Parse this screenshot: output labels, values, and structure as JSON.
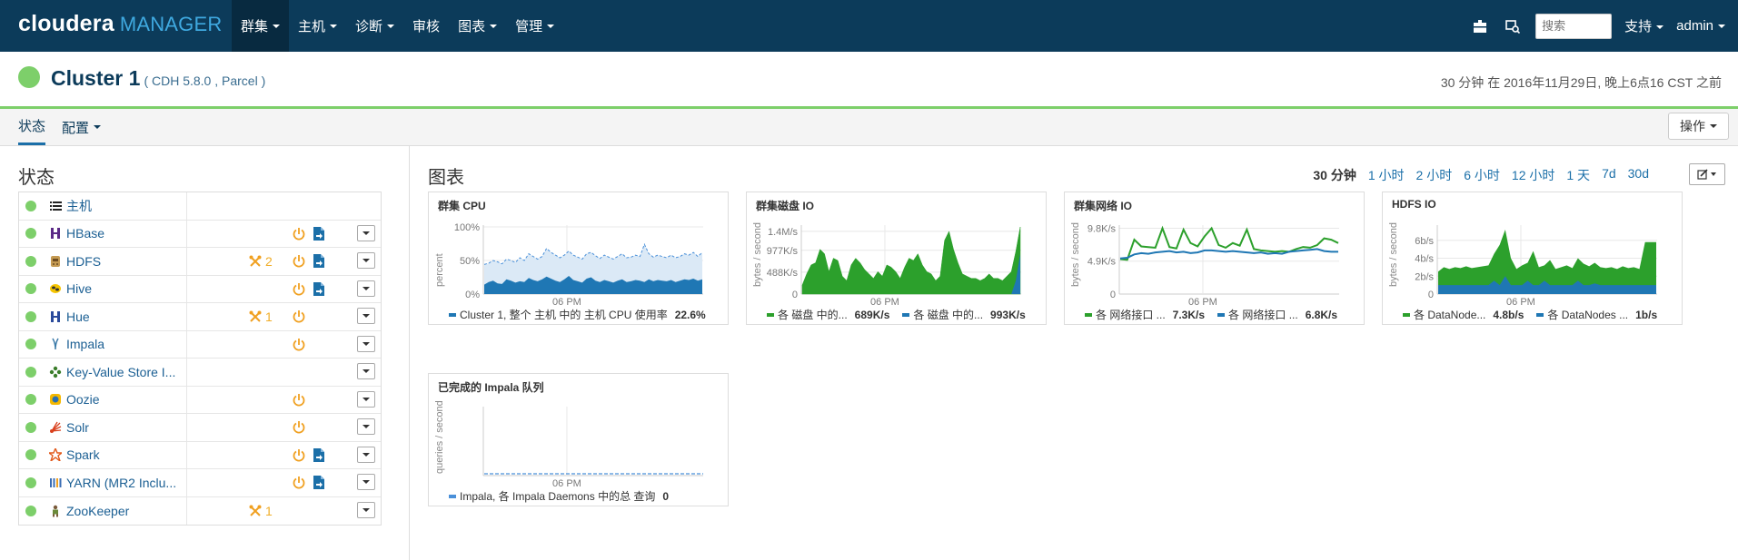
{
  "app": {
    "brand": "cloudera",
    "brand_suffix": "MANAGER",
    "nav": [
      {
        "label": "群集",
        "active": true
      },
      {
        "label": "主机"
      },
      {
        "label": "诊断"
      },
      {
        "label": "审核"
      },
      {
        "label": "图表"
      },
      {
        "label": "管理"
      }
    ],
    "search_placeholder": "搜索",
    "support_label": "支持",
    "user_label": "admin",
    "accent": "#0c3b5a"
  },
  "header": {
    "cluster_name": "Cluster 1",
    "cluster_sub": "( CDH 5.8.0 , Parcel )",
    "timestamp": "30 分钟 在 2016年11月29日, 晚上6点16 CST 之前",
    "status_color": "#7dcf6a"
  },
  "tabs": {
    "status": "状态",
    "config": "配置",
    "actions": "操作"
  },
  "status_panel": {
    "title": "状态",
    "services": [
      {
        "name": "主机",
        "icon": "list-icon"
      },
      {
        "name": "HBase",
        "icon": "hbase-icon",
        "power": true,
        "file": true
      },
      {
        "name": "HDFS",
        "icon": "hdfs-icon",
        "alert": "2",
        "power": true,
        "file": true
      },
      {
        "name": "Hive",
        "icon": "hive-icon",
        "power": true,
        "file": true
      },
      {
        "name": "Hue",
        "icon": "hue-icon",
        "alert": "1",
        "power": true
      },
      {
        "name": "Impala",
        "icon": "impala-icon",
        "power": true
      },
      {
        "name": "Key-Value Store I...",
        "icon": "kvstore-icon"
      },
      {
        "name": "Oozie",
        "icon": "oozie-icon",
        "power": true
      },
      {
        "name": "Solr",
        "icon": "solr-icon",
        "power": true
      },
      {
        "name": "Spark",
        "icon": "spark-icon",
        "power": true,
        "file": true
      },
      {
        "name": "YARN (MR2 Inclu...",
        "icon": "yarn-icon",
        "power": true,
        "file": true
      },
      {
        "name": "ZooKeeper",
        "icon": "zookeeper-icon",
        "alert": "1"
      }
    ]
  },
  "charts_panel": {
    "title": "图表",
    "time_ranges": [
      "30 分钟",
      "1 小时",
      "2 小时",
      "6 小时",
      "12 小时",
      "1 天",
      "7d",
      "30d"
    ],
    "active_range": "30 分钟"
  },
  "chart_data": [
    {
      "type": "area",
      "title": "群集 CPU",
      "ylabel": "percent",
      "yticks": [
        "100%",
        "50%",
        "0%"
      ],
      "ylim": [
        0,
        100
      ],
      "xtick": "06 PM",
      "colors": {
        "fill": "#1f77b4",
        "band": "#dbe9f6",
        "dash": "#4a90d9"
      },
      "series": [
        {
          "name": "Cluster 1, 整个 主机 中的 主机 CPU 使用率",
          "legend_value": "22.6%",
          "values": [
            14,
            18,
            20,
            16,
            15,
            22,
            20,
            17,
            19,
            18,
            24,
            21,
            19,
            22,
            26,
            23,
            20,
            18,
            22,
            27,
            21,
            19,
            17,
            23,
            25,
            20,
            18,
            21,
            19,
            17,
            20,
            22,
            18,
            19,
            21,
            20,
            18,
            22,
            19,
            21,
            20,
            19,
            21,
            18,
            20,
            22,
            21,
            23,
            20,
            22
          ]
        },
        {
          "name": "max",
          "values": [
            44,
            46,
            50,
            48,
            45,
            52,
            50,
            47,
            54,
            50,
            60,
            56,
            52,
            56,
            68,
            62,
            58,
            54,
            58,
            64,
            58,
            55,
            52,
            60,
            62,
            57,
            53,
            58,
            55,
            52,
            56,
            60,
            54,
            55,
            58,
            56,
            74,
            60,
            55,
            58,
            56,
            54,
            58,
            54,
            56,
            60,
            58,
            62,
            56,
            62
          ]
        }
      ]
    },
    {
      "type": "area",
      "title": "群集磁盘 IO",
      "ylabel": "bytes / second",
      "yticks": [
        "1.4M/s",
        "977K/s",
        "488K/s",
        "0"
      ],
      "ylim": [
        0,
        1500
      ],
      "xtick": "06 PM",
      "colors": {
        "fill": "#2ca02c",
        "line": "#1f77b4"
      },
      "series": [
        {
          "name": "各 磁盘 中的...",
          "legend_value": "689K/s",
          "values": [
            200,
            450,
            650,
            700,
            1000,
            900,
            500,
            800,
            750,
            400,
            300,
            650,
            800,
            700,
            550,
            450,
            350,
            500,
            400,
            650,
            600,
            500,
            350,
            600,
            800,
            750,
            900,
            650,
            500,
            450,
            300,
            400,
            1200,
            1400,
            1000,
            700,
            450,
            400,
            350,
            350,
            300,
            350,
            450,
            350,
            350,
            300,
            400,
            500,
            950,
            1500
          ]
        },
        {
          "name": "各 磁盘 中的...",
          "legend_value": "993K/s",
          "values": [
            0,
            0,
            0,
            0,
            0,
            0,
            0,
            0,
            0,
            0,
            0,
            0,
            0,
            0,
            0,
            0,
            0,
            0,
            0,
            0,
            0,
            0,
            0,
            0,
            0,
            0,
            0,
            0,
            0,
            0,
            0,
            0,
            0,
            0,
            0,
            0,
            0,
            0,
            0,
            0,
            0,
            0,
            0,
            0,
            0,
            0,
            0,
            0,
            300,
            900
          ]
        }
      ]
    },
    {
      "type": "line",
      "title": "群集网络 IO",
      "ylabel": "bytes / second",
      "yticks": [
        "9.8K/s",
        "4.9K/s",
        "0"
      ],
      "ylim": [
        0,
        10000
      ],
      "xtick": "06 PM",
      "colors": {
        "a": "#2ca02c",
        "b": "#1f77b4"
      },
      "series": [
        {
          "name": "各 网络接口 ...",
          "legend_value": "7.3K/s",
          "values": [
            5200,
            5100,
            8100,
            7100,
            7000,
            6900,
            9800,
            7000,
            6800,
            9600,
            7600,
            7100,
            8600,
            9800,
            7300,
            6900,
            7600,
            7200,
            9600,
            6700,
            6500,
            6400,
            6300,
            6400,
            6300,
            6700,
            7000,
            6900,
            7300,
            8300,
            8100,
            7600
          ]
        },
        {
          "name": "各 网络接口 ...",
          "legend_value": "6.8K/s",
          "values": [
            5300,
            5400,
            5900,
            6100,
            6000,
            6200,
            6300,
            6400,
            6200,
            6300,
            6100,
            6200,
            6500,
            6500,
            6400,
            6300,
            6400,
            6300,
            6200,
            6100,
            6200,
            6000,
            6100,
            6000,
            6300,
            6400,
            6500,
            6600,
            6700,
            6400,
            6300,
            6300
          ]
        }
      ]
    },
    {
      "type": "area",
      "title": "HDFS IO",
      "ylabel": "bytes / second",
      "yticks": [
        "6b/s",
        "4b/s",
        "2b/s",
        "0"
      ],
      "ylim": [
        0,
        7.5
      ],
      "xtick": "06 PM",
      "colors": {
        "a": "#2ca02c",
        "b": "#1f77b4"
      },
      "series": [
        {
          "name": "各 DataNode...",
          "legend_value": "4.8b/s",
          "values": [
            2.5,
            3.0,
            2.8,
            3.0,
            2.9,
            3.1,
            2.9,
            3.0,
            3.1,
            3.2,
            4.5,
            5.5,
            7.2,
            4.0,
            2.8,
            3.2,
            3.5,
            4.8,
            3.0,
            3.2,
            3.8,
            2.8,
            3.0,
            3.2,
            2.9,
            4.0,
            3.4,
            3.1,
            3.5,
            3.0,
            2.9,
            3.0,
            2.8,
            3.1,
            2.9,
            3.0,
            2.8,
            5.8,
            5.8,
            5.8
          ]
        },
        {
          "name": "各 DataNodes ...",
          "legend_value": "1b/s",
          "values": [
            1,
            1,
            1,
            1,
            1,
            1,
            1,
            1,
            1,
            1,
            1.5,
            1,
            2,
            1,
            1,
            1,
            1.5,
            1,
            1,
            1.5,
            1,
            1,
            1,
            1,
            1,
            1.5,
            1,
            1,
            1.2,
            1,
            1,
            1,
            1,
            1,
            1,
            1,
            1,
            1,
            1,
            1
          ]
        }
      ]
    },
    {
      "type": "line",
      "title": "已完成的 Impala 队列",
      "ylabel": "queries / second",
      "yticks": [],
      "ylim": [
        0,
        1
      ],
      "xtick": "06 PM",
      "colors": {
        "a": "#4a90d9"
      },
      "series": [
        {
          "name": "Impala, 各 Impala Daemons 中的总 查询",
          "legend_value": "0",
          "values": [
            0,
            0,
            0,
            0,
            0,
            0,
            0,
            0,
            0,
            0,
            0,
            0,
            0,
            0,
            0,
            0,
            0,
            0,
            0,
            0
          ]
        }
      ]
    }
  ]
}
